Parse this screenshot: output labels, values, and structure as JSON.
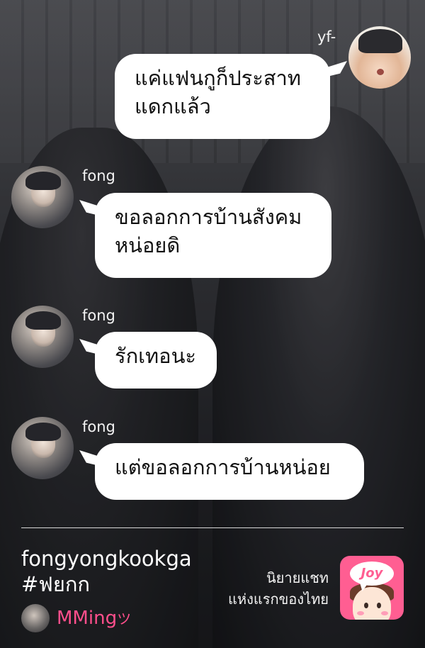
{
  "messages": [
    {
      "sender": "yf-",
      "side": "right",
      "lines": [
        "แค่แฟนกูก็ประสาท",
        "แดกแล้ว"
      ]
    },
    {
      "sender": "fong",
      "side": "left",
      "lines": [
        "ขอลอกการบ้านสังคม",
        "หน่อยดิ"
      ]
    },
    {
      "sender": "fong",
      "side": "left",
      "lines": [
        "รักเทอนะ"
      ]
    },
    {
      "sender": "fong",
      "side": "left",
      "lines": [
        "แต่ขอลอกการบ้านหน่อย"
      ]
    }
  ],
  "footer": {
    "story_title": "fongyongkookga",
    "hashtag": "#ฟยกก",
    "author": "MMing",
    "author_glyph": "ツ",
    "tagline_line1": "นิยายแชท",
    "tagline_line2": "แห่งแรกของไทย",
    "app_logo_text": "Joy",
    "brand_color": "#ff5e92"
  }
}
